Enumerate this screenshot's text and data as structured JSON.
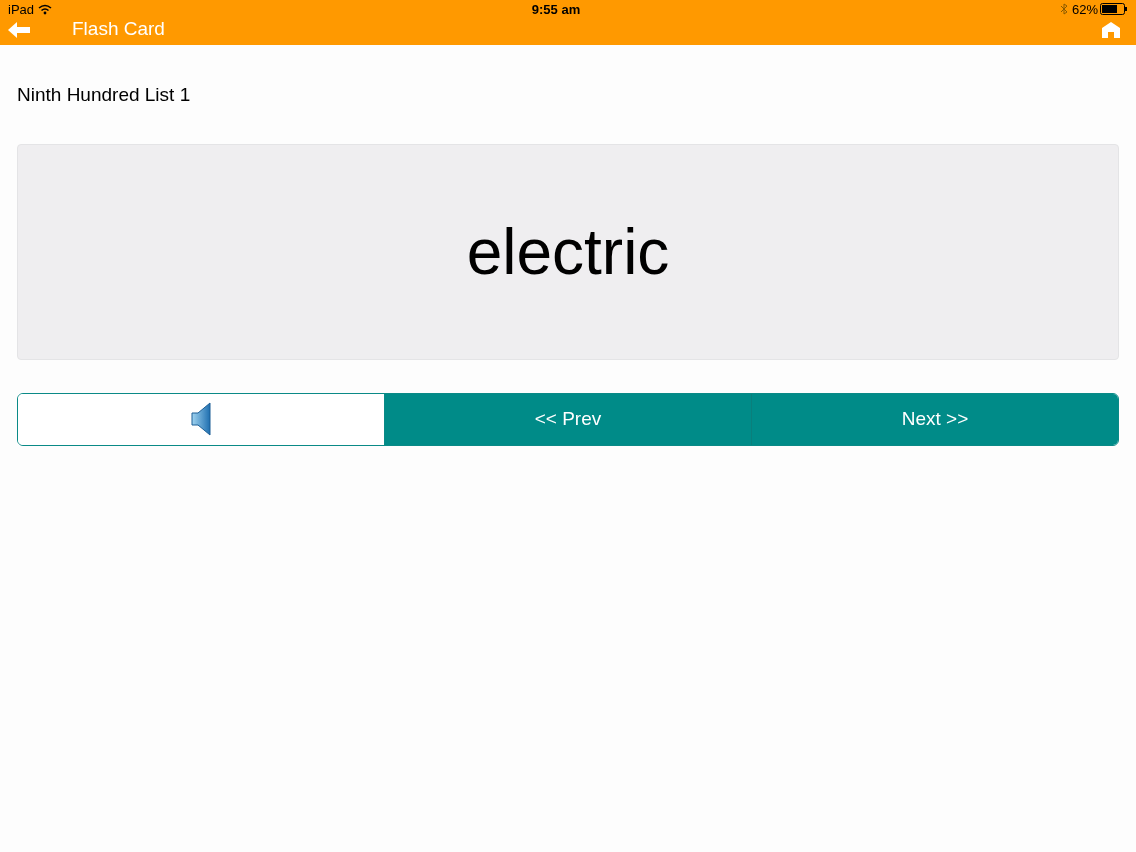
{
  "status_bar": {
    "device": "iPad",
    "time": "9:55 am",
    "battery": "62%"
  },
  "header": {
    "title": "Flash Card"
  },
  "list_title": "Ninth Hundred List 1",
  "card": {
    "word": "electric"
  },
  "buttons": [
    {
      "kind": "sound"
    },
    {
      "kind": "nav",
      "label": "<< Prev"
    },
    {
      "kind": "nav",
      "label": "Next >>"
    }
  ]
}
